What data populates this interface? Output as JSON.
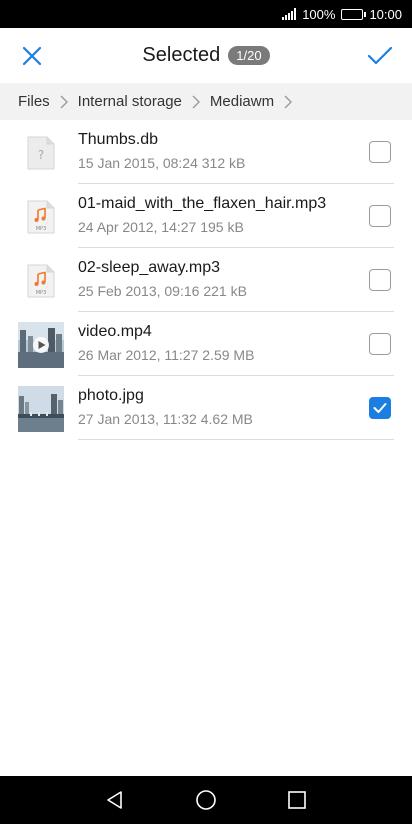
{
  "status_bar": {
    "battery_percent": "100%",
    "time": "10:00",
    "battery_level": 1.0
  },
  "header": {
    "title": "Selected",
    "count": "1/20",
    "close_icon": "close-icon",
    "confirm_icon": "checkmark-icon",
    "accent_color": "#1a7fe0"
  },
  "breadcrumb": [
    "Files",
    "Internal storage",
    "Mediawm"
  ],
  "files": [
    {
      "name": "Thumbs.db",
      "meta": "15 Jan 2015, 08:24 312 kB",
      "icon": "unknown-file-icon",
      "checked": false
    },
    {
      "name": "01-maid_with_the_flaxen_hair.mp3",
      "meta": "24 Apr 2012, 14:27 195 kB",
      "icon": "music-file-icon",
      "checked": false
    },
    {
      "name": "02-sleep_away.mp3",
      "meta": "25 Feb 2013, 09:16 221 kB",
      "icon": "music-file-icon",
      "checked": false
    },
    {
      "name": "video.mp4",
      "meta": "26 Mar 2012, 11:27 2.59 MB",
      "icon": "video-thumbnail",
      "checked": false
    },
    {
      "name": "photo.jpg",
      "meta": "27 Jan 2013, 11:32 4.62 MB",
      "icon": "photo-thumbnail",
      "checked": true
    }
  ],
  "nav": {
    "back_icon": "back-icon",
    "home_icon": "home-icon",
    "recents_icon": "recents-icon"
  }
}
